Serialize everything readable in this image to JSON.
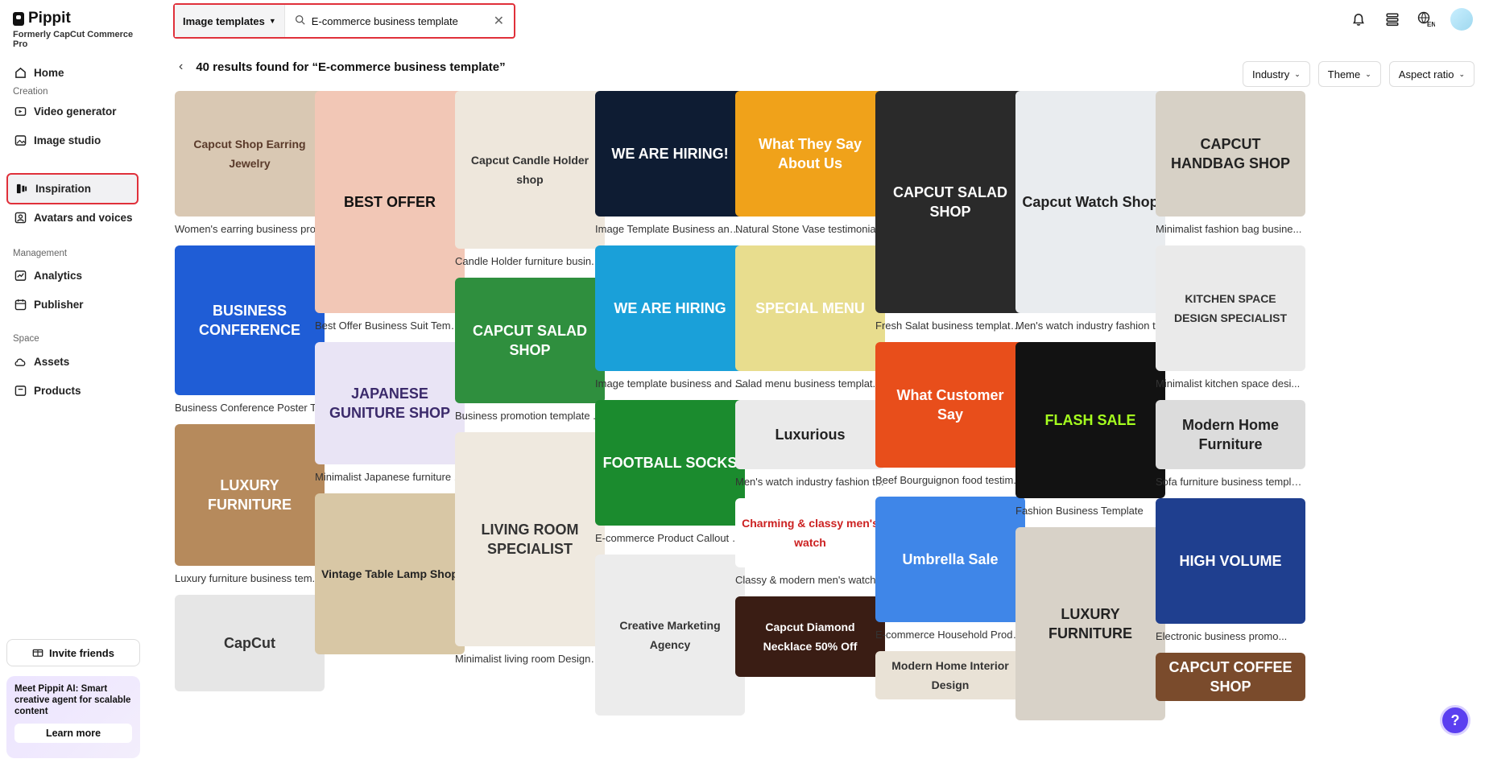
{
  "brand": {
    "name": "Pippit",
    "subtitle": "Formerly CapCut Commerce Pro"
  },
  "nav": {
    "home": "Home",
    "creation_label": "Creation",
    "video_generator": "Video generator",
    "image_studio": "Image studio",
    "inspiration": "Inspiration",
    "avatars": "Avatars and voices",
    "management_label": "Management",
    "analytics": "Analytics",
    "publisher": "Publisher",
    "space_label": "Space",
    "assets": "Assets",
    "products": "Products"
  },
  "invite": "Invite friends",
  "promo": {
    "title": "Meet Pippit AI:",
    "body": "Smart creative agent for scalable content",
    "button": "Learn more"
  },
  "search": {
    "type": "Image templates",
    "query": "E-commerce business template"
  },
  "results": {
    "text": "40 results found for “E-commerce business template”"
  },
  "filters": [
    "Industry",
    "Theme",
    "Aspect ratio"
  ],
  "colors": {
    "accent": "#e0303a",
    "help": "#5b3ff0"
  },
  "columns": [
    [
      {
        "caption": "Women's earring business pro...",
        "art": "Capcut Shop Earring Jewelry"
      },
      {
        "caption": "Business Conference Poster T...",
        "art": "BUSINESS CONFERENCE"
      },
      {
        "caption": "Luxury furniture business tem...",
        "art": "LUXURY FURNITURE"
      },
      {
        "caption": "",
        "art": "CapCut"
      }
    ],
    [
      {
        "caption": "Best Offer Business Suit Temp...",
        "art": "BEST OFFER"
      },
      {
        "caption": "Minimalist Japanese furniture ...",
        "art": "JAPANESE GUNITURE SHOP"
      },
      {
        "caption": "",
        "art": "Vintage Table Lamp Shop"
      }
    ],
    [
      {
        "caption": "Candle Holder furniture busin...",
        "art": "Capcut Candle Holder shop"
      },
      {
        "caption": "Business promotion template ...",
        "art": "CAPCUT SALAD SHOP"
      },
      {
        "caption": "Minimalist living room Designe...",
        "art": "LIVING ROOM SPECIALIST"
      }
    ],
    [
      {
        "caption": "Image Template Business and ...",
        "art": "WE ARE HIRING!"
      },
      {
        "caption": "Image template business and ...",
        "art": "WE ARE HIRING"
      },
      {
        "caption": "E-commerce Product Callout F...",
        "art": "FOOTBALL SOCKS"
      },
      {
        "caption": "",
        "art": "Creative Marketing Agency"
      }
    ],
    [
      {
        "caption": "Natural Stone Vase testimonia...",
        "art": "What They Say About Us"
      },
      {
        "caption": "Salad menu business templat...",
        "art": "SPECIAL MENU"
      },
      {
        "caption": "Men's watch industry fashion t...",
        "art": "Luxurious"
      },
      {
        "caption": "Classy & modern men's watch...",
        "art": "Charming & classy men's watch"
      },
      {
        "caption": "",
        "art": "Capcut Diamond Necklace 50% Off"
      }
    ],
    [
      {
        "caption": "Fresh Salat business template ...",
        "art": "CAPCUT SALAD SHOP"
      },
      {
        "caption": "Beef Bourguignon food testim...",
        "art": "What Customer Say"
      },
      {
        "caption": "E-commerce Household Produ...",
        "art": "Umbrella Sale"
      },
      {
        "caption": "",
        "art": "Modern Home Interior Design"
      }
    ],
    [
      {
        "caption": "Men's watch industry fashion t...",
        "art": "Capcut Watch Shop"
      },
      {
        "caption": "Fashion Business Template",
        "art": "FLASH SALE"
      },
      {
        "caption": "",
        "art": "LUXURY FURNITURE"
      }
    ],
    [
      {
        "caption": "Minimalist fashion bag busine...",
        "art": "CAPCUT HANDBAG SHOP"
      },
      {
        "caption": "Minimalist kitchen space desi...",
        "art": "KITCHEN SPACE DESIGN SPECIALIST"
      },
      {
        "caption": "Sofa furniture business templa...",
        "art": "Modern Home Furniture"
      },
      {
        "caption": "Electronic business promo...",
        "art": "HIGH VOLUME"
      },
      {
        "caption": "",
        "art": "CAPCUT COFFEE SHOP"
      }
    ]
  ]
}
